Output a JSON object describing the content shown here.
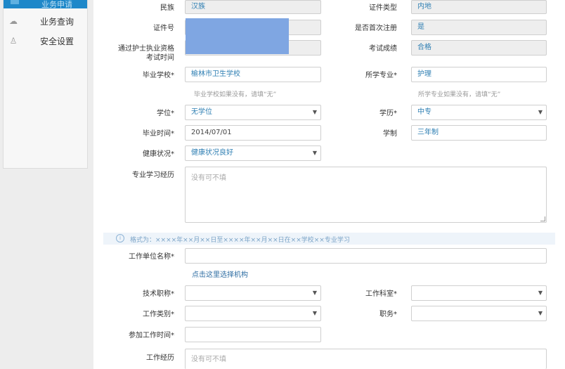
{
  "sidebar": {
    "active_label": "业务申请",
    "items": [
      {
        "label": "业务查询",
        "icon": "cloud-icon"
      },
      {
        "label": "安全设置",
        "icon": "user-icon"
      }
    ]
  },
  "form": {
    "ethnicity": {
      "label": "民族",
      "value": "汉族"
    },
    "id_type": {
      "label": "证件类型",
      "value": "内地"
    },
    "id_number": {
      "label": "证件号"
    },
    "first_registration": {
      "label": "是否首次注册",
      "value": "是"
    },
    "exam_time": {
      "label_line1": "通过护士执业资格",
      "label_line2": "考试时间"
    },
    "exam_result": {
      "label": "考试成绩",
      "value": "合格"
    },
    "school": {
      "label": "毕业学校*",
      "value": "榆林市卫生学校",
      "hint": "毕业学校如果没有，请填“无”"
    },
    "major": {
      "label": "所学专业*",
      "value": "护理",
      "hint": "所学专业如果没有，请填“无”"
    },
    "degree": {
      "label": "学位*",
      "value": "无学位"
    },
    "education": {
      "label": "学历*",
      "value": "中专"
    },
    "grad_time": {
      "label": "毕业时间*",
      "value": "2014/07/01"
    },
    "school_system": {
      "label": "学制",
      "value": "三年制"
    },
    "health": {
      "label": "健康状况*",
      "value": "健康状况良好"
    },
    "study_history": {
      "label": "专业学习经历",
      "placeholder": "没有可不填"
    },
    "format_hint": "格式为：××××年××月××日至××××年××月××日在××学校××专业学习",
    "work_unit": {
      "label": "工作单位名称*",
      "link": "点击这里选择机构"
    },
    "tech_title": {
      "label": "技术职称*"
    },
    "department": {
      "label": "工作科室*"
    },
    "work_category": {
      "label": "工作类别*"
    },
    "position": {
      "label": "职务*"
    },
    "work_start": {
      "label": "参加工作时间*"
    },
    "work_history": {
      "label": "工作经历",
      "placeholder": "没有可不填"
    }
  },
  "colors": {
    "accent": "#1e88c9",
    "value_text": "#2f7fb3",
    "redacted": "#7fa6e2"
  }
}
